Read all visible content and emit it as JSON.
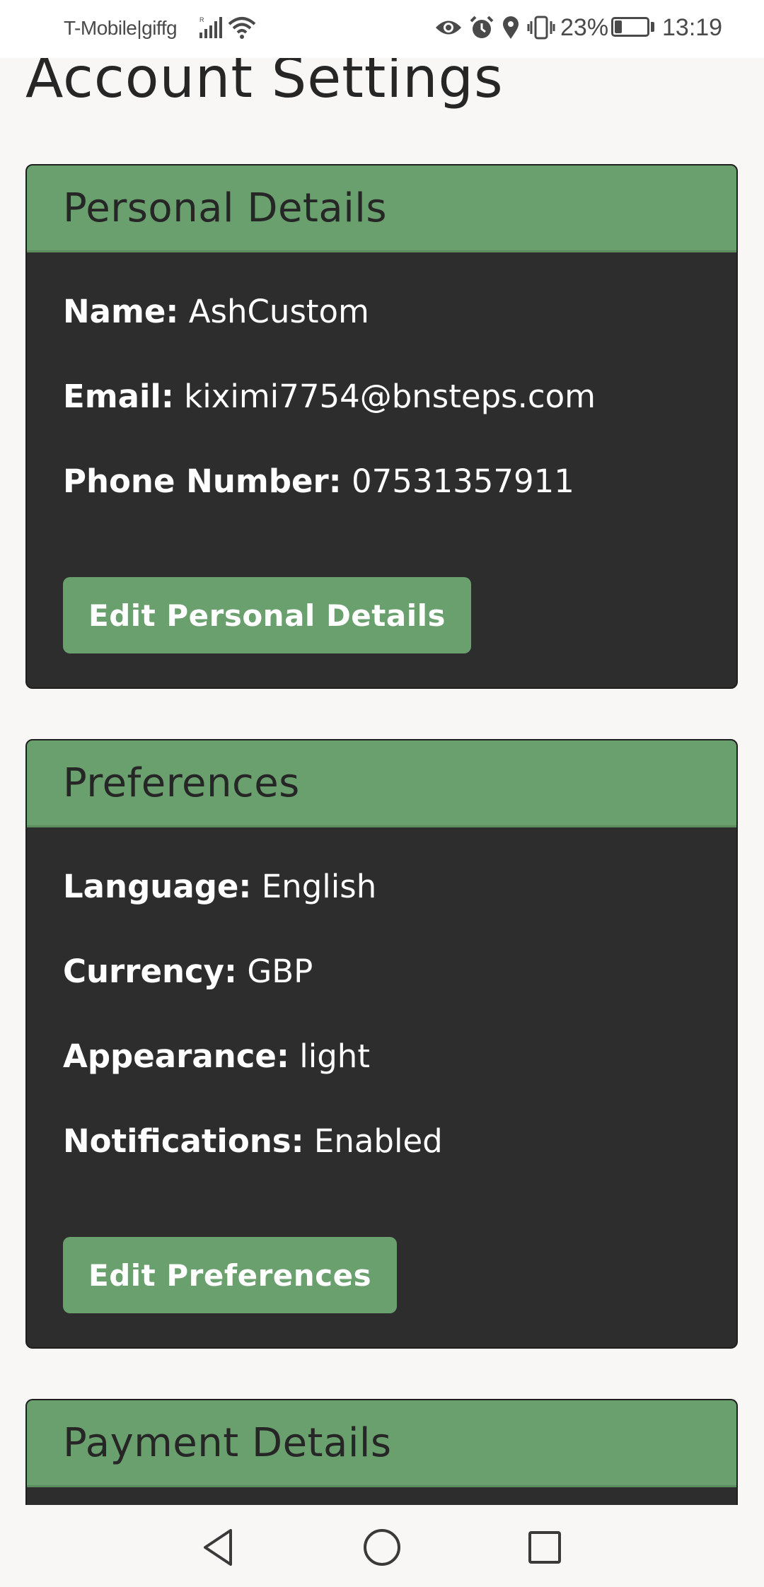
{
  "status_bar": {
    "carrier": "T-Mobile|giffg",
    "battery": "23%",
    "battery_level": 0.23,
    "time": "13:19"
  },
  "page": {
    "title": "Account Settings"
  },
  "personal": {
    "title": "Personal Details",
    "fields": [
      {
        "label": "Name:",
        "value": "AshCustom"
      },
      {
        "label": "Email:",
        "value": "kiximi7754@bnsteps.com"
      },
      {
        "label": "Phone Number:",
        "value": "07531357911"
      }
    ],
    "button": "Edit Personal Details"
  },
  "preferences": {
    "title": "Preferences",
    "fields": [
      {
        "label": "Language:",
        "value": "English"
      },
      {
        "label": "Currency:",
        "value": "GBP"
      },
      {
        "label": "Appearance:",
        "value": "light"
      },
      {
        "label": "Notifications:",
        "value": "Enabled"
      }
    ],
    "button": "Edit Preferences"
  },
  "payment": {
    "title": "Payment Details"
  },
  "colors": {
    "accent": "#6a9f6e",
    "card_bg": "#2d2d2d",
    "page_bg": "#f8f7f6"
  },
  "icons": {
    "status": [
      "signal-icon",
      "wifi-icon",
      "eye-icon",
      "alarm-icon",
      "location-icon",
      "vibrate-icon",
      "battery-icon"
    ],
    "nav": [
      "back-icon",
      "home-icon",
      "recents-icon"
    ]
  }
}
